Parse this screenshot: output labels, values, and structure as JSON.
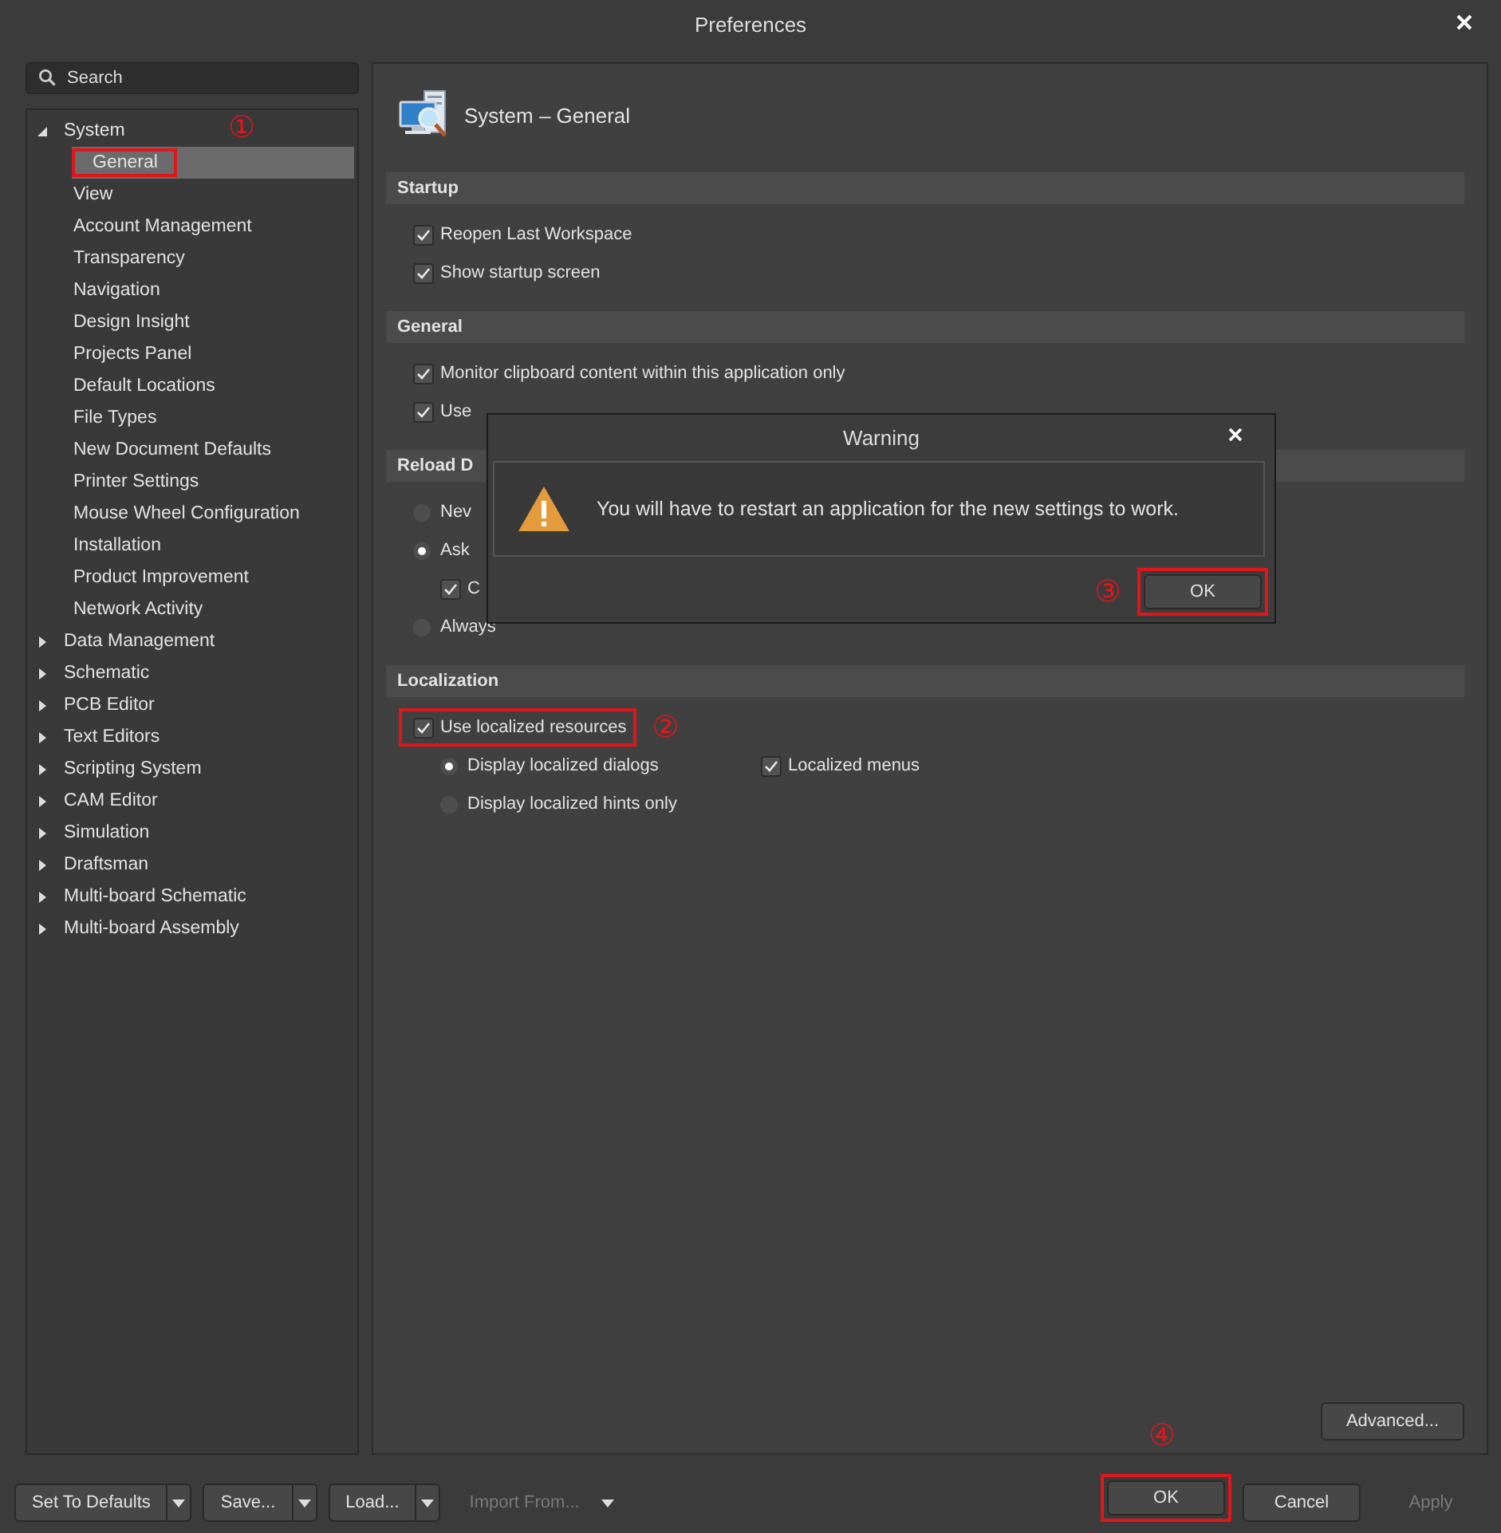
{
  "window": {
    "title": "Preferences"
  },
  "search": {
    "placeholder": "Search"
  },
  "tree": [
    {
      "label": "System",
      "expanded": true,
      "selected": false,
      "children": [
        {
          "label": "General",
          "selected": true,
          "annotation": "①"
        },
        {
          "label": "View",
          "selected": false
        },
        {
          "label": "Account Management",
          "selected": false
        },
        {
          "label": "Transparency",
          "selected": false
        },
        {
          "label": "Navigation",
          "selected": false
        },
        {
          "label": "Design Insight",
          "selected": false
        },
        {
          "label": "Projects Panel",
          "selected": false
        },
        {
          "label": "Default Locations",
          "selected": false
        },
        {
          "label": "File Types",
          "selected": false
        },
        {
          "label": "New Document Defaults",
          "selected": false
        },
        {
          "label": "Printer Settings",
          "selected": false
        },
        {
          "label": "Mouse Wheel Configuration",
          "selected": false
        },
        {
          "label": "Installation",
          "selected": false
        },
        {
          "label": "Product Improvement",
          "selected": false
        },
        {
          "label": "Network Activity",
          "selected": false
        }
      ]
    },
    {
      "label": "Data Management",
      "expanded": false,
      "selected": false
    },
    {
      "label": "Schematic",
      "expanded": false,
      "selected": false
    },
    {
      "label": "PCB Editor",
      "expanded": false,
      "selected": false
    },
    {
      "label": "Text Editors",
      "expanded": false,
      "selected": false
    },
    {
      "label": "Scripting System",
      "expanded": false,
      "selected": false
    },
    {
      "label": "CAM Editor",
      "expanded": false,
      "selected": false
    },
    {
      "label": "Simulation",
      "expanded": false,
      "selected": false
    },
    {
      "label": "Draftsman",
      "expanded": false,
      "selected": false
    },
    {
      "label": "Multi-board Schematic",
      "expanded": false,
      "selected": false
    },
    {
      "label": "Multi-board Assembly",
      "expanded": false,
      "selected": false
    }
  ],
  "page": {
    "title": "System – General",
    "sections": [
      {
        "title": "Startup",
        "options": [
          {
            "kind": "checkbox",
            "label": "Reopen Last Workspace",
            "checked": true
          },
          {
            "kind": "checkbox",
            "label": "Show startup screen",
            "checked": true
          }
        ]
      },
      {
        "title": "General",
        "options": [
          {
            "kind": "checkbox",
            "label": "Monitor clipboard content within this application only",
            "checked": true
          },
          {
            "kind": "checkbox",
            "label": "Use",
            "checked": true
          }
        ]
      },
      {
        "title": "Reload D",
        "options": [
          {
            "kind": "radio",
            "label": "Nev",
            "selected": false
          },
          {
            "kind": "radio",
            "label": "Ask",
            "selected": true,
            "children": [
              {
                "kind": "checkbox",
                "label": "C",
                "checked": true
              }
            ]
          },
          {
            "kind": "radio",
            "label": "Always",
            "selected": false
          }
        ]
      },
      {
        "title": "Localization",
        "options": [
          {
            "kind": "checkbox",
            "label": "Use localized resources",
            "checked": true,
            "annotation": "②",
            "children": [
              {
                "kind": "radio",
                "label": "Display localized dialogs",
                "selected": true
              },
              {
                "kind": "checkbox",
                "label": "Localized menus",
                "checked": true
              },
              {
                "kind": "radio",
                "label": "Display localized hints only",
                "selected": false
              }
            ]
          }
        ]
      }
    ],
    "advanced_button": "Advanced..."
  },
  "dialog": {
    "title": "Warning",
    "message": "You will have to restart an application for the new settings to work.",
    "button": {
      "label": "OK",
      "annotation": "③"
    }
  },
  "footer": {
    "left_buttons": [
      {
        "label": "Set To Defaults",
        "disabled": false
      },
      {
        "label": "Save...",
        "disabled": false
      },
      {
        "label": "Load...",
        "disabled": false
      },
      {
        "label": "Import From...",
        "disabled": true
      }
    ],
    "right_buttons": [
      {
        "label": "OK",
        "disabled": false,
        "annotation": "④"
      },
      {
        "label": "Cancel",
        "disabled": false
      },
      {
        "label": "Apply",
        "disabled": true
      }
    ]
  }
}
